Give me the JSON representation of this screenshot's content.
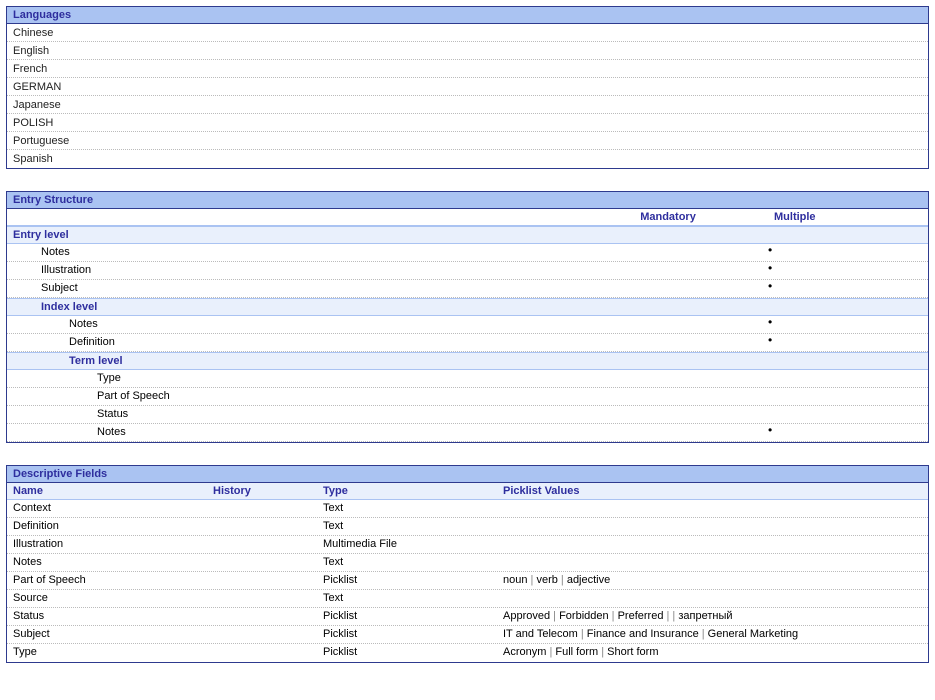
{
  "languages": {
    "title": "Languages",
    "items": [
      "Chinese",
      "English",
      "French",
      "GERMAN",
      "Japanese",
      "POLISH",
      "Portuguese",
      "Spanish"
    ]
  },
  "entry_structure": {
    "title": "Entry Structure",
    "headers": {
      "mandatory": "Mandatory",
      "multiple": "Multiple"
    },
    "levels": [
      {
        "name": "Entry level",
        "indent": 0,
        "rows": [
          {
            "label": "Notes",
            "mandatory": false,
            "multiple": true
          },
          {
            "label": "Illustration",
            "mandatory": false,
            "multiple": true
          },
          {
            "label": "Subject",
            "mandatory": false,
            "multiple": true
          }
        ]
      },
      {
        "name": "Index level",
        "indent": 1,
        "rows": [
          {
            "label": "Notes",
            "mandatory": false,
            "multiple": true
          },
          {
            "label": "Definition",
            "mandatory": false,
            "multiple": true
          }
        ]
      },
      {
        "name": "Term level",
        "indent": 2,
        "rows": [
          {
            "label": "Type",
            "mandatory": false,
            "multiple": false
          },
          {
            "label": "Part of Speech",
            "mandatory": false,
            "multiple": false
          },
          {
            "label": "Status",
            "mandatory": false,
            "multiple": false
          },
          {
            "label": "Notes",
            "mandatory": false,
            "multiple": true
          }
        ]
      }
    ]
  },
  "descriptive_fields": {
    "title": "Descriptive Fields",
    "headers": {
      "name": "Name",
      "history": "History",
      "type": "Type",
      "values": "Picklist Values"
    },
    "rows": [
      {
        "name": "Context",
        "history": "",
        "type": "Text",
        "values": []
      },
      {
        "name": "Definition",
        "history": "",
        "type": "Text",
        "values": []
      },
      {
        "name": "Illustration",
        "history": "",
        "type": "Multimedia File",
        "values": []
      },
      {
        "name": "Notes",
        "history": "",
        "type": "Text",
        "values": []
      },
      {
        "name": "Part of Speech",
        "history": "",
        "type": "Picklist",
        "values": [
          "noun",
          "verb",
          "adjective"
        ]
      },
      {
        "name": "Source",
        "history": "",
        "type": "Text",
        "values": []
      },
      {
        "name": "Status",
        "history": "",
        "type": "Picklist",
        "values": [
          "Approved",
          "Forbidden",
          "Preferred",
          "",
          "запретный"
        ]
      },
      {
        "name": "Subject",
        "history": "",
        "type": "Picklist",
        "values": [
          "IT and Telecom",
          "Finance and Insurance",
          "General Marketing"
        ]
      },
      {
        "name": "Type",
        "history": "",
        "type": "Picklist",
        "values": [
          "Acronym",
          "Full form",
          "Short form"
        ]
      }
    ]
  }
}
